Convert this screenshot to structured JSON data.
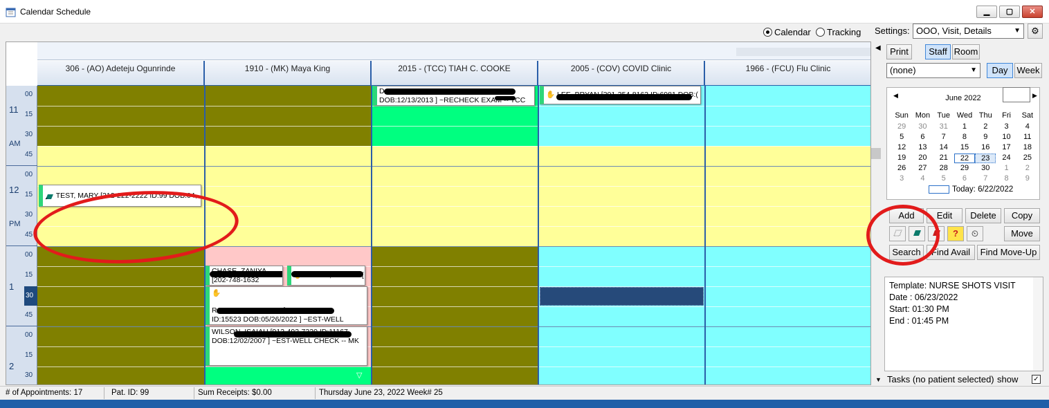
{
  "window": {
    "title": "Calendar Schedule"
  },
  "view": {
    "calendar_label": "Calendar",
    "tracking_label": "Tracking"
  },
  "settings": {
    "label": "Settings:",
    "value": "OOO, Visit, Details"
  },
  "buttons": {
    "print": "Print",
    "staff": "Staff",
    "room": "Room",
    "day": "Day",
    "week": "Week",
    "add": "Add",
    "edit": "Edit",
    "delete": "Delete",
    "copy": "Copy",
    "move": "Move",
    "search": "Search",
    "find_avail": "Find Avail",
    "find_move_up": "Find Move-Up"
  },
  "filter": {
    "value": "(none)"
  },
  "columns": [
    "306  - (AO) Adeteju Ogunrinde",
    "1910  - (MK) Maya King",
    "2015  - (TCC) TIAH C. COOKE",
    "2005  - (COV) COVID Clinic",
    "1966  - (FCU) Flu Clinic"
  ],
  "times": {
    "h11": "11",
    "am": "AM",
    "h12": "12",
    "pm": "PM",
    "h1": "1",
    "h2": "2",
    "m00": "00",
    "m15": "15",
    "m30": "30",
    "m45": "45"
  },
  "appointments": {
    "test_mary": "TEST, MARY [212-222-2222 ID:99 DOB:04,",
    "tcc_line1": "D                                          ID:9184",
    "tcc_line2": "DOB:12/13/2013 ] ~RECHECK EXAM -- TCC",
    "covid_line1": "LEE, BRYAN [301-354-8163 ID:6981 DOB:(",
    "chase_z_line1": "CHASE, ZANIYA",
    "chase_z_line2": "[202-748-1632",
    "chase_zak_line1": "CHASE, ZAKARI [",
    "rodriguez_line1": "RODRIGUEZ, XAIRE [301-357-1180",
    "rodriguez_line2": "ID:15523 DOB:05/26/2022 ] ~EST-WELL",
    "wilson_line1": "WILSON, ISAIAH [912-492-7320 ID:11167",
    "wilson_line2": "DOB:12/02/2007 ] ~EST-WELL CHECK -- MK"
  },
  "minical": {
    "month": "June 2022",
    "weekdays": [
      "Sun",
      "Mon",
      "Tue",
      "Wed",
      "Thu",
      "Fri",
      "Sat"
    ],
    "weeks": [
      [
        "29",
        "30",
        "31",
        "1",
        "2",
        "3",
        "4"
      ],
      [
        "5",
        "6",
        "7",
        "8",
        "9",
        "10",
        "11"
      ],
      [
        "12",
        "13",
        "14",
        "15",
        "16",
        "17",
        "18"
      ],
      [
        "19",
        "20",
        "21",
        "22",
        "23",
        "24",
        "25"
      ],
      [
        "26",
        "27",
        "28",
        "29",
        "30",
        "1",
        "2"
      ],
      [
        "3",
        "4",
        "5",
        "6",
        "7",
        "8",
        "9"
      ]
    ],
    "today": "Today: 6/22/2022"
  },
  "info": {
    "template": "Template:  NURSE SHOTS VISIT",
    "date": "Date : 06/23/2022",
    "start": "Start: 01:30 PM",
    "end": "End : 01:45 PM"
  },
  "tasks": {
    "label": "Tasks (no patient selected)",
    "show": "show"
  },
  "status": {
    "appointments": "# of Appointments: 17",
    "pat_id": "Pat. ID: 99",
    "receipts": "Sum Receipts: $0.00",
    "date": "Thursday June 23, 2022 Week# 25"
  },
  "colors": {
    "olive": "#808000",
    "cyan": "#80ffff",
    "yellow": "#ffff99",
    "green": "#00ff80",
    "pink": "#ffc8c8",
    "selected": "#264a7a",
    "annotation": "#e21b1b"
  }
}
